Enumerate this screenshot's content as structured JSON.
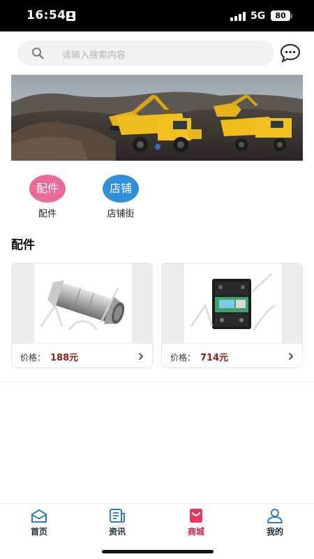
{
  "status_bar": {
    "time": "16:54",
    "network": "5G",
    "battery": "80"
  },
  "search": {
    "placeholder": "请输入搜索内容",
    "icon": "search-icon"
  },
  "header": {
    "message_icon": "chat-bubble-icon"
  },
  "categories": [
    {
      "circle_text": "配件",
      "label": "配件",
      "color": "#ec6a9a"
    },
    {
      "circle_text": "店铺",
      "label": "店铺街",
      "color": "#2f8fd8"
    }
  ],
  "section": {
    "title": "配件"
  },
  "products": [
    {
      "price_label": "价格：",
      "price": "188元",
      "image": "check-valve-product-image"
    },
    {
      "price_label": "价格：",
      "price": "714元",
      "image": "motor-protector-product-image"
    }
  ],
  "tabs": [
    {
      "label": "首页",
      "icon": "home-icon",
      "active": false
    },
    {
      "label": "资讯",
      "icon": "news-icon",
      "active": false
    },
    {
      "label": "商城",
      "icon": "shopping-bag-icon",
      "active": true
    },
    {
      "label": "我的",
      "icon": "user-icon",
      "active": false
    }
  ],
  "colors": {
    "accent": "#cc1f4e",
    "price": "#9b1a1a",
    "tab_text": "#1a2a3a",
    "icon_blue": "#2b7fc0"
  }
}
